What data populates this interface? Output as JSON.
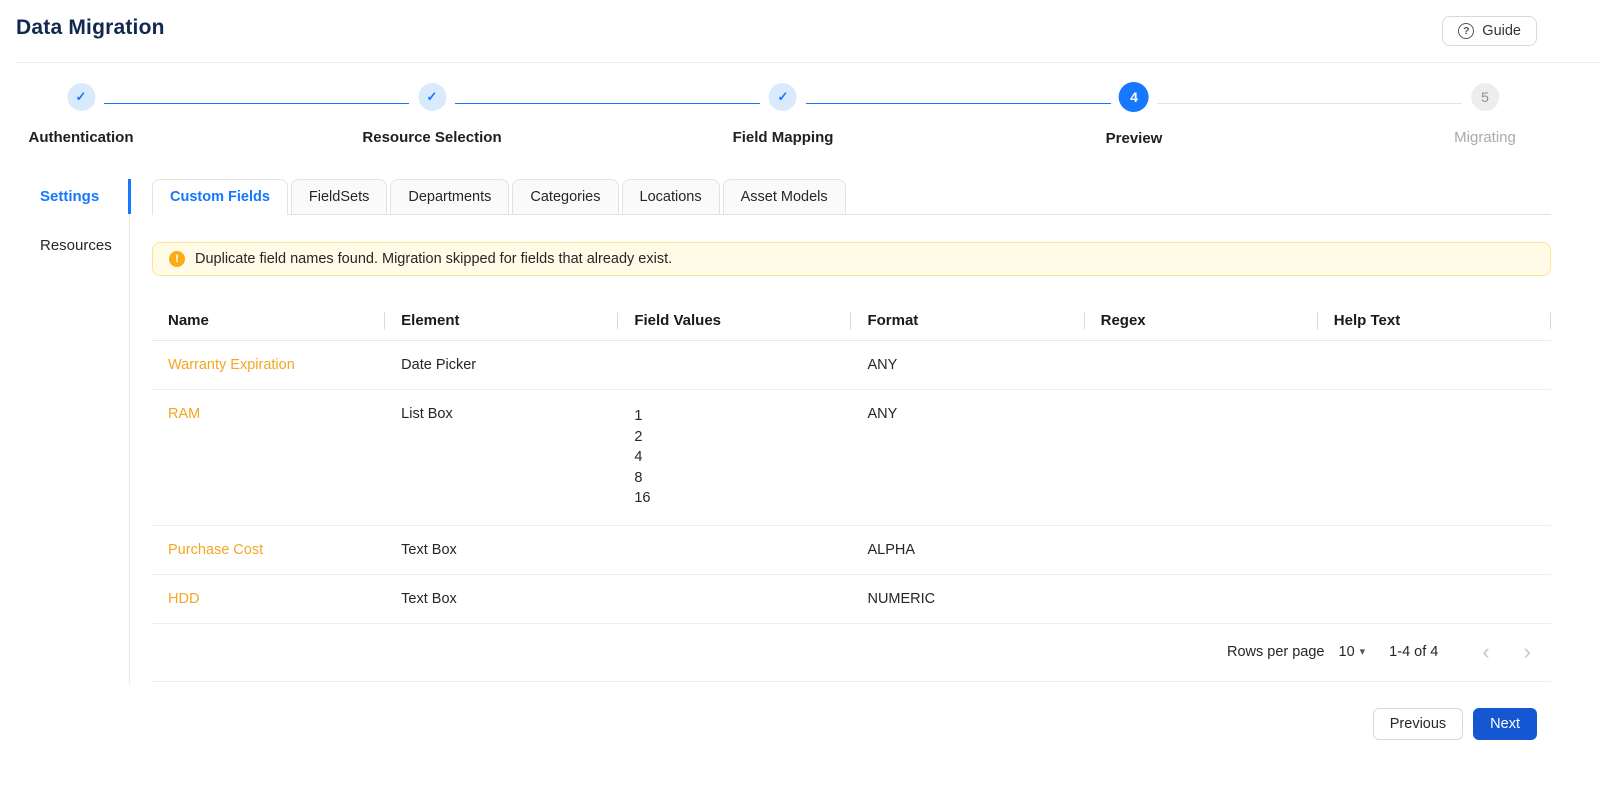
{
  "header": {
    "title": "Data Migration",
    "guide_label": "Guide"
  },
  "stepper": {
    "steps": [
      {
        "label": "Authentication",
        "status": "complete"
      },
      {
        "label": "Resource Selection",
        "status": "complete"
      },
      {
        "label": "Field Mapping",
        "status": "complete"
      },
      {
        "label": "Preview",
        "status": "active",
        "number": "4"
      },
      {
        "label": "Migrating",
        "status": "pending",
        "number": "5"
      }
    ]
  },
  "sidebar": {
    "items": [
      {
        "label": "Settings",
        "active": true
      },
      {
        "label": "Resources",
        "active": false
      }
    ]
  },
  "tabs": [
    {
      "label": "Custom Fields",
      "active": true
    },
    {
      "label": "FieldSets",
      "active": false
    },
    {
      "label": "Departments",
      "active": false
    },
    {
      "label": "Categories",
      "active": false
    },
    {
      "label": "Locations",
      "active": false
    },
    {
      "label": "Asset Models",
      "active": false
    }
  ],
  "alert": {
    "message": "Duplicate field names found. Migration skipped for fields that already exist."
  },
  "table": {
    "columns": [
      "Name",
      "Element",
      "Field Values",
      "Format",
      "Regex",
      "Help Text"
    ],
    "rows": [
      {
        "name": "Warranty Expiration",
        "element": "Date Picker",
        "field_values": [],
        "format": "ANY",
        "regex": "",
        "help_text": ""
      },
      {
        "name": "RAM",
        "element": "List Box",
        "field_values": [
          "1",
          "2",
          "4",
          "8",
          "16"
        ],
        "format": "ANY",
        "regex": "",
        "help_text": ""
      },
      {
        "name": "Purchase Cost",
        "element": "Text Box",
        "field_values": [],
        "format": "ALPHA",
        "regex": "",
        "help_text": ""
      },
      {
        "name": "HDD",
        "element": "Text Box",
        "field_values": [],
        "format": "NUMERIC",
        "regex": "",
        "help_text": ""
      }
    ]
  },
  "pagination": {
    "rows_per_page_label": "Rows per page",
    "rows_per_page_value": "10",
    "range_label": "1-4 of 4"
  },
  "footer": {
    "previous_label": "Previous",
    "next_label": "Next"
  },
  "icons": {
    "guide_glyph": "?",
    "alert_glyph": "!",
    "check_glyph": "✓",
    "caret_down": "▾",
    "chevron_left": "‹",
    "chevron_right": "›"
  },
  "colors": {
    "accent": "#1677ff",
    "heading": "#12294f",
    "link": "#f5a623",
    "warning-bg": "#fffbe6",
    "warning-border": "#ffe58f",
    "warning-icon": "#faad14",
    "primary-btn": "#1557d2",
    "complete-bg": "#d8eafc",
    "pending-bg": "#ededed"
  }
}
